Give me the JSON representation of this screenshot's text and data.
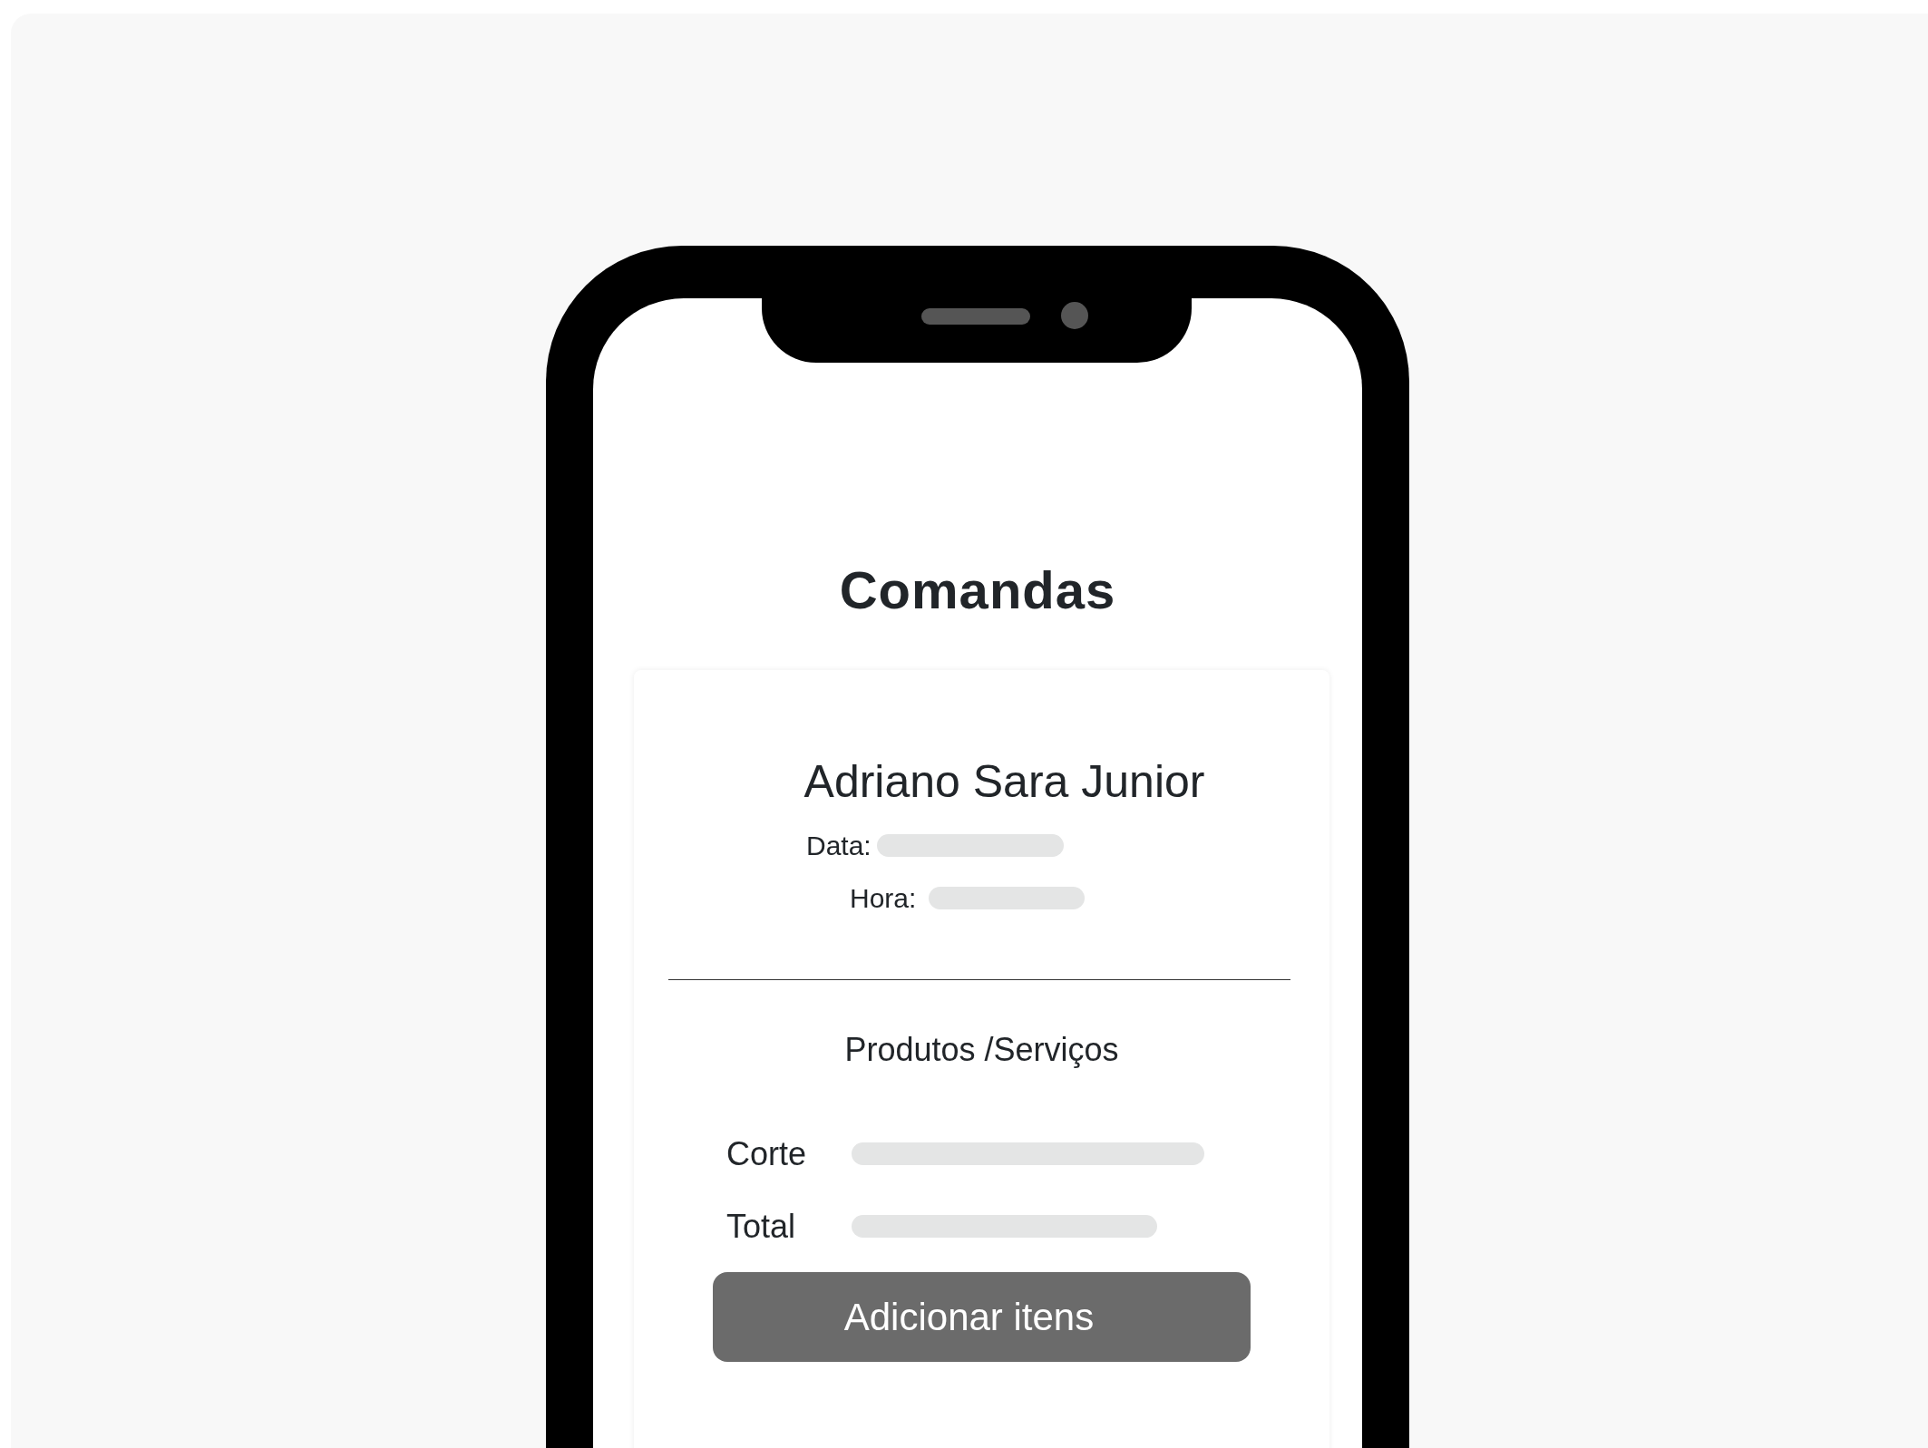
{
  "screen_title": "Comandas",
  "order": {
    "customer_name": "Adriano Sara Junior",
    "fields": [
      {
        "label": "Data:"
      },
      {
        "label": "Hora:"
      }
    ],
    "section_title": "Produtos /Serviços",
    "items": [
      {
        "label": "Corte"
      },
      {
        "label": "Total"
      }
    ],
    "button": "Adicionar itens"
  }
}
